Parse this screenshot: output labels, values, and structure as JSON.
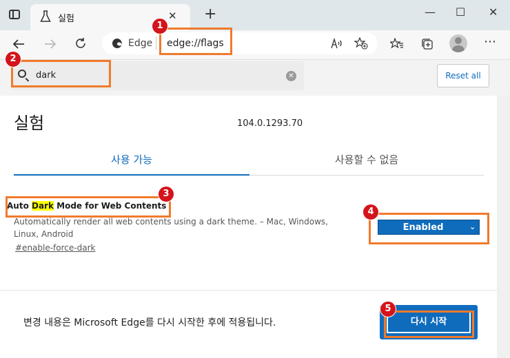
{
  "browser": {
    "tab_title": "실험",
    "tab_close": "✕",
    "new_tab": "+",
    "address_brand": "Edge",
    "address_url": "edge://flags",
    "window_controls": [
      "—",
      "☐",
      "✕"
    ],
    "icons": [
      "tabs-icon",
      "flask-icon",
      "back-icon",
      "forward-icon",
      "refresh-icon",
      "edge-logo",
      "read-aloud-icon",
      "add-favorite-icon",
      "favorites-icon",
      "collections-icon",
      "profile-icon",
      "more-icon"
    ]
  },
  "search": {
    "value": "dark",
    "reset_label": "Reset all"
  },
  "page": {
    "title": "실험",
    "version": "104.0.1293.70",
    "tabs": [
      {
        "label": "사용 가능",
        "active": true
      },
      {
        "label": "사용할 수 없음",
        "active": false
      }
    ]
  },
  "flag": {
    "title_before": "Auto ",
    "title_highlight": "Dark",
    "title_after": " Mode for Web Contents",
    "description": "Automatically render all web contents using a dark theme. – Mac, Windows, Linux, Android",
    "link": "#enable-force-dark",
    "select_value": "Enabled"
  },
  "footer": {
    "message": "변경 내용은 Microsoft Edge를 다시 시작한 후에 적용됩니다.",
    "relaunch_label": "다시 시작"
  },
  "annotations": {
    "badges": [
      "1",
      "2",
      "3",
      "4",
      "5"
    ],
    "color": "#f07a2c",
    "badge_color": "#d4141b"
  },
  "colors": {
    "accent": "#0f6cbd",
    "highlight": "#ffff00"
  }
}
